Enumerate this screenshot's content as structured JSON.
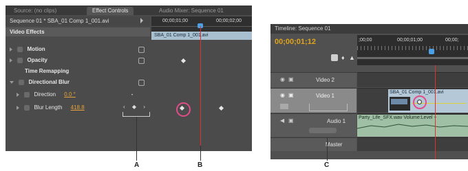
{
  "effect_controls": {
    "tabs": [
      "Source: (no clips)",
      "Effect Controls",
      "Audio Mixer: Sequence 01"
    ],
    "sequence_header": "Sequence 01 * SBA_01 Comp 1_001.avi",
    "timecodes": [
      "00;00;01;00",
      "00;00;02;00"
    ],
    "section_label": "Video Effects",
    "clip_name": "SBA_01 Comp 1_001.avi",
    "rows": {
      "motion": "Motion",
      "opacity": "Opacity",
      "time_remapping": "Time Remapping",
      "directional_blur": "Directional Blur",
      "direction": "Direction",
      "direction_value": "0.0 °",
      "blur_length": "Blur Length",
      "blur_length_value": "418.8"
    }
  },
  "timeline": {
    "tab": "Timeline: Sequence 01",
    "current_time": "00;00;01;12",
    "ruler": [
      ";00;00",
      "00;00;01;00",
      "00;00;"
    ],
    "tracks": {
      "video2": "Video 2",
      "video1": "Video 1",
      "audio1": "Audio 1",
      "master": "Master"
    },
    "video_clip": "SBA_01 Comp 1_001.avi",
    "audio_clip": "Party_Life_SFX.wav  Volume:Level +"
  },
  "callouts": [
    "A",
    "B",
    "C"
  ],
  "colors": {
    "panel": "#4b4b4b",
    "timecode_orange": "#e0a31e",
    "highlight_ring": "#e24c88",
    "playhead": "#e03030"
  }
}
